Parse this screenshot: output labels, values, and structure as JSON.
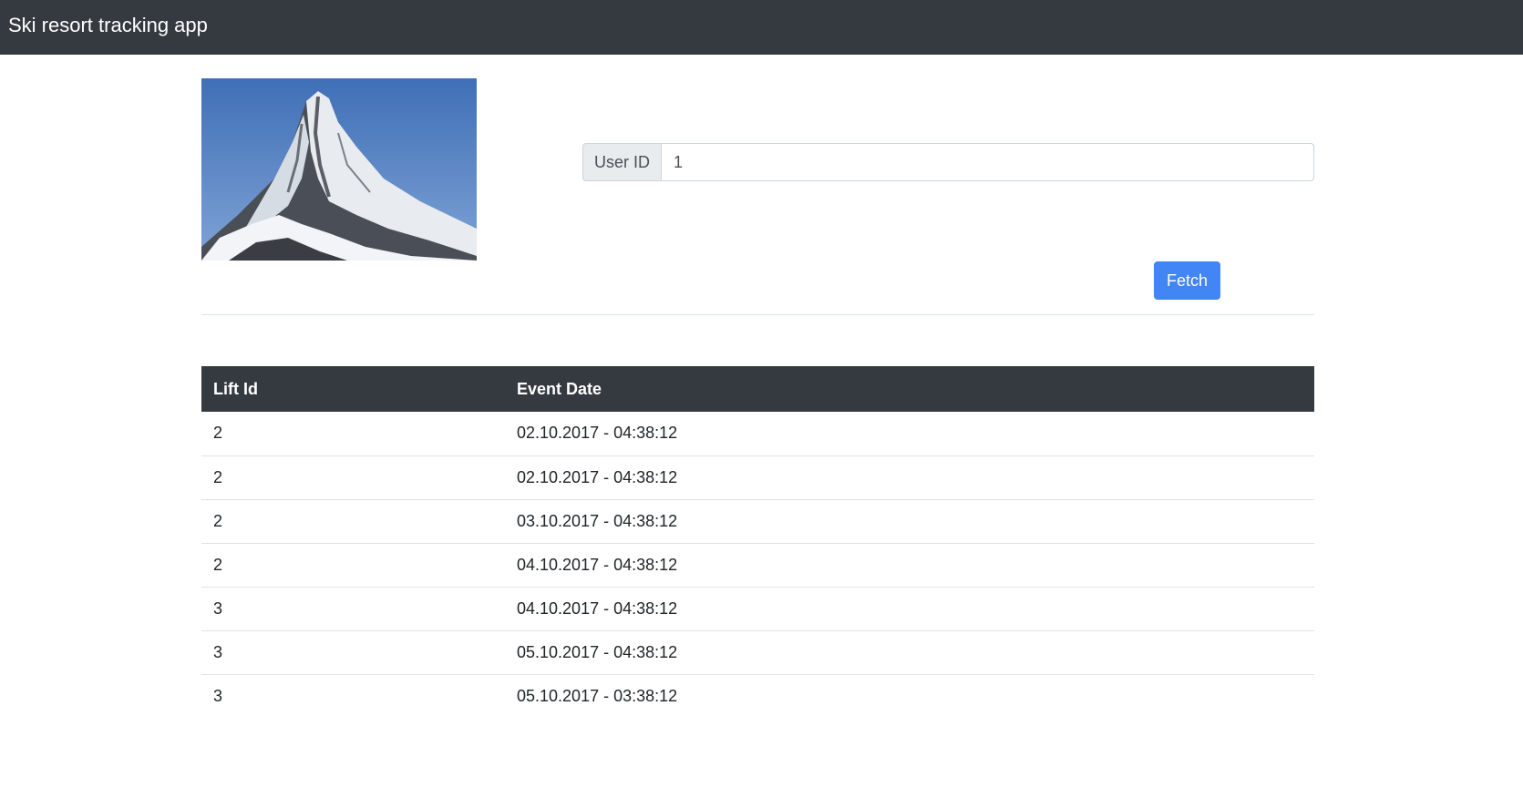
{
  "navbar": {
    "title": "Ski resort tracking app"
  },
  "form": {
    "user_id_label": "User ID",
    "user_id_value": "1",
    "fetch_label": "Fetch"
  },
  "table": {
    "headers": [
      "Lift Id",
      "Event Date"
    ],
    "rows": [
      {
        "lift_id": "2",
        "event_date": "02.10.2017 - 04:38:12"
      },
      {
        "lift_id": "2",
        "event_date": "02.10.2017 - 04:38:12"
      },
      {
        "lift_id": "2",
        "event_date": "03.10.2017 - 04:38:12"
      },
      {
        "lift_id": "2",
        "event_date": "04.10.2017 - 04:38:12"
      },
      {
        "lift_id": "3",
        "event_date": "04.10.2017 - 04:38:12"
      },
      {
        "lift_id": "3",
        "event_date": "05.10.2017 - 04:38:12"
      },
      {
        "lift_id": "3",
        "event_date": "05.10.2017 - 03:38:12"
      }
    ]
  },
  "colors": {
    "navbar_bg": "#343a40",
    "table_header_bg": "#343a40",
    "button_primary": "#4285f4"
  }
}
